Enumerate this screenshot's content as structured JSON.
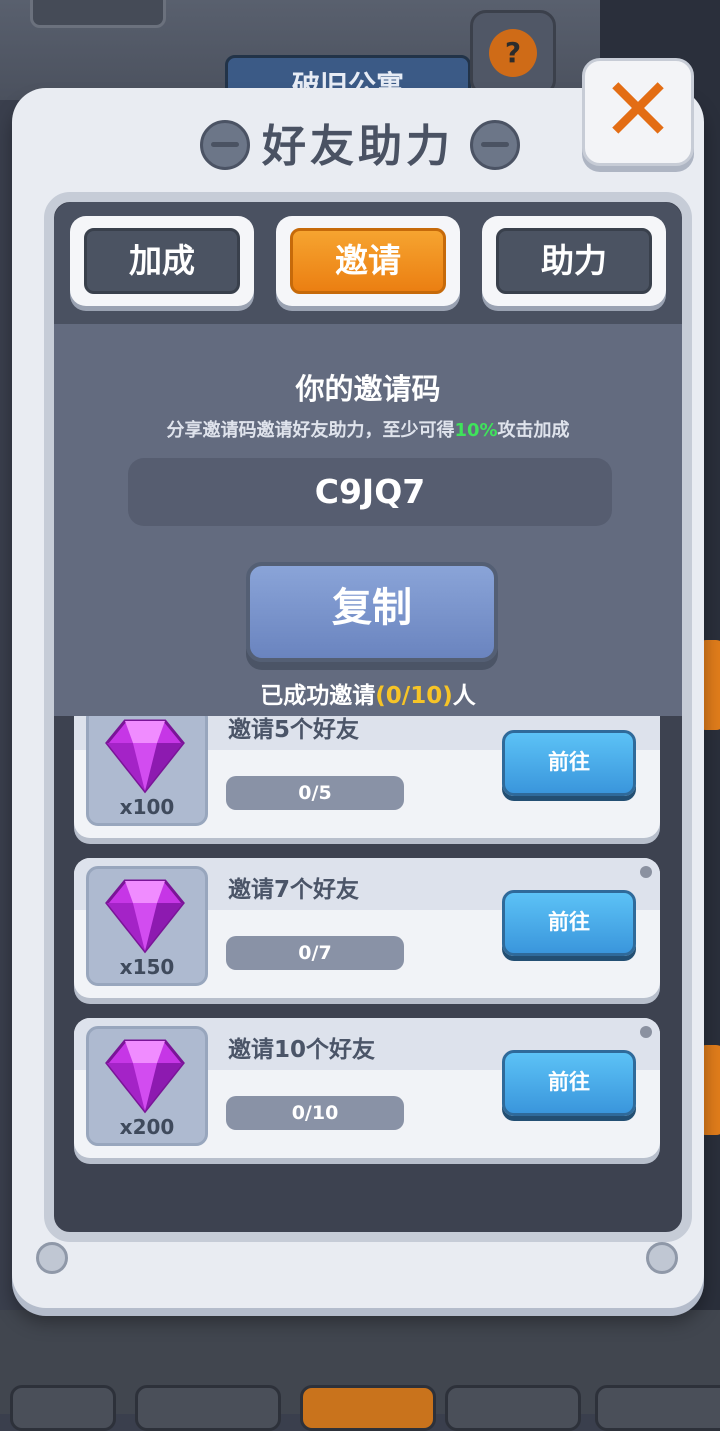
{
  "background": {
    "banner_text": "破旧公寓",
    "help_glyph": "?"
  },
  "dialog": {
    "title": "好友助力",
    "close_glyph": "✕"
  },
  "tabs": [
    {
      "label": "加成",
      "active": false
    },
    {
      "label": "邀请",
      "active": true
    },
    {
      "label": "助力",
      "active": false
    }
  ],
  "invite": {
    "heading": "你的邀请码",
    "desc_prefix": "分享邀请码邀请好友助力，至少可得",
    "desc_highlight": "10%",
    "desc_suffix": "攻击加成",
    "code": "C9JQ7",
    "copy_label": "复制",
    "invited_prefix": "已成功邀请",
    "invited_count": "(0/10)",
    "invited_suffix": "人"
  },
  "rewards": [
    {
      "title": "邀请5个好友",
      "gem_qty": "x100",
      "progress_text": "0/5",
      "progress": 0,
      "button": "前往"
    },
    {
      "title": "邀请7个好友",
      "gem_qty": "x150",
      "progress_text": "0/7",
      "progress": 0,
      "button": "前往"
    },
    {
      "title": "邀请10个好友",
      "gem_qty": "x200",
      "progress_text": "0/10",
      "progress": 0,
      "button": "前往"
    }
  ],
  "colors": {
    "accent_orange": "#eb7f12",
    "highlight_green": "#3fe35b",
    "highlight_yellow": "#f6c427",
    "go_button_blue": "#3a96dc",
    "gem_purple": "#c636e6"
  },
  "icons": {
    "close": "close-icon",
    "reward": "gem-icon",
    "help": "help-icon"
  }
}
